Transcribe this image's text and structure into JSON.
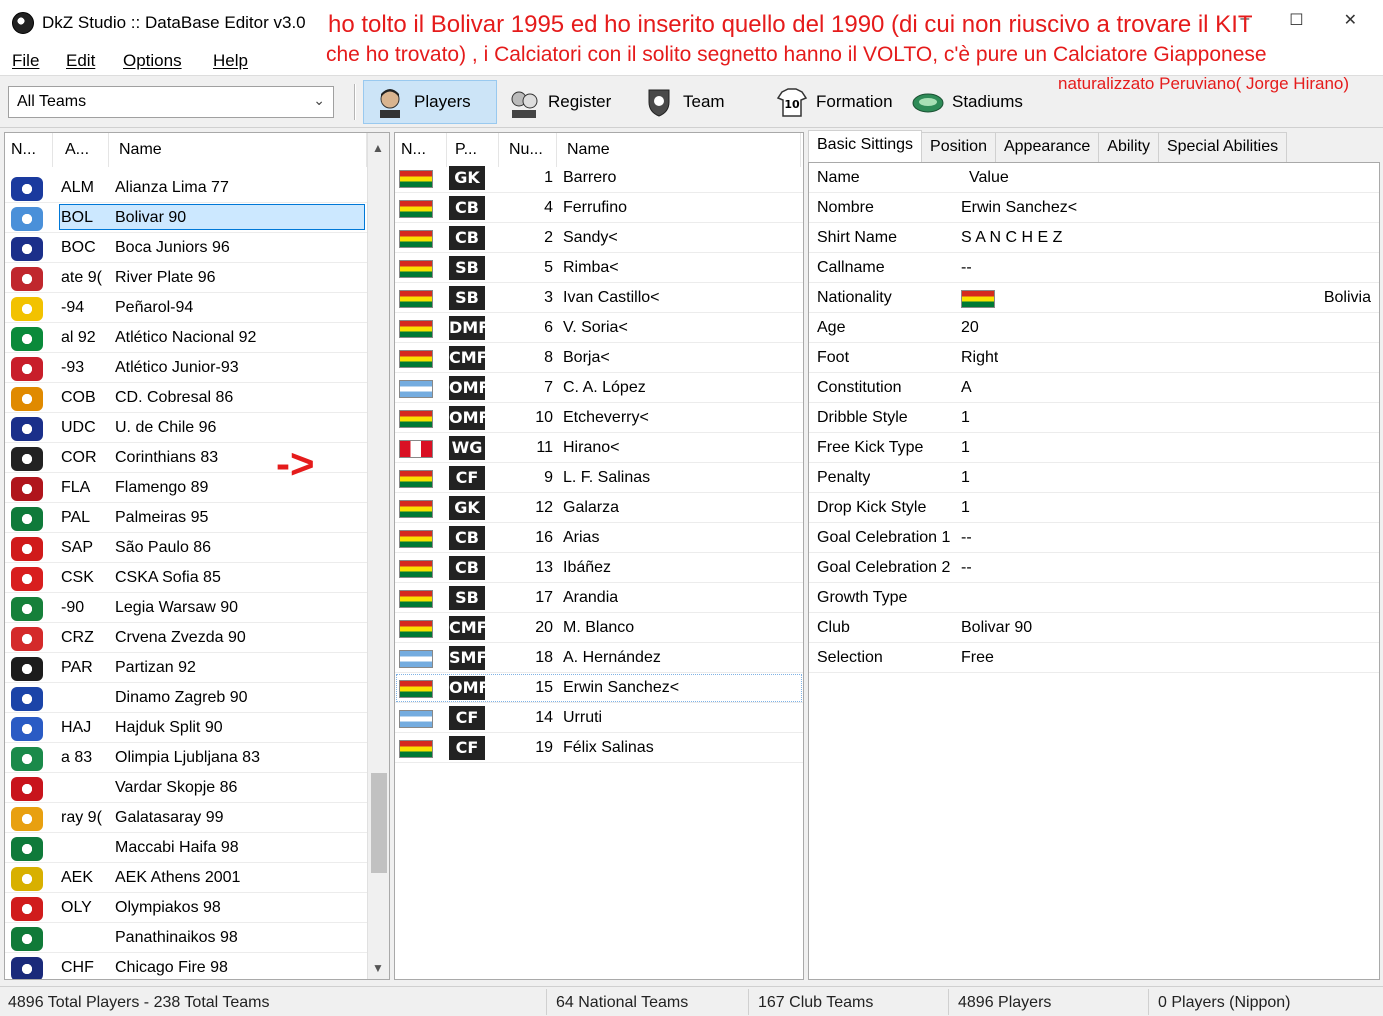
{
  "window": {
    "title": "DkZ Studio :: DataBase Editor v3.0",
    "minimize": "–",
    "maximize": "☐",
    "close": "✕"
  },
  "menu": [
    "File",
    "Edit",
    "Options",
    "Help"
  ],
  "annotation": {
    "line1": "ho tolto il Bolivar 1995 ed ho inserito quello del 1990 (di cui non riuscivo a trovare il KIT",
    "line2": "che ho trovato) , i Calciatori con il solito segnetto hanno il VOLTO, c'è pure un Calciatore Giapponese",
    "line3": "naturalizzato Peruviano( Jorge Hirano)",
    "arrow": "->"
  },
  "toolbar": {
    "team_filter": "All Teams",
    "buttons": [
      "Players",
      "Register",
      "Team",
      "Formation",
      "Stadiums"
    ],
    "formation_badge": "10"
  },
  "teams_table": {
    "headers": [
      "N...",
      "A...",
      "Name"
    ],
    "rows": [
      {
        "abbr": "ALM",
        "name": "Alianza Lima 77",
        "color": "#1a3a9e"
      },
      {
        "abbr": "BOL",
        "name": "Bolivar 90",
        "color": "#4a90d9",
        "selected": true
      },
      {
        "abbr": "BOC",
        "name": "Boca Juniors 96",
        "color": "#1b2f8a"
      },
      {
        "abbr": "ate 9(",
        "name": "River Plate 96",
        "color": "#c0272d"
      },
      {
        "abbr": "-94",
        "name": "Peñarol-94",
        "color": "#f2c200"
      },
      {
        "abbr": "al 92",
        "name": "Atlético Nacional 92",
        "color": "#0a8a3a"
      },
      {
        "abbr": "-93",
        "name": "Atlético Junior-93",
        "color": "#c81e2a"
      },
      {
        "abbr": "COB",
        "name": "CD. Cobresal 86",
        "color": "#e08a00"
      },
      {
        "abbr": "UDC",
        "name": "U. de Chile 96",
        "color": "#1a2f8a"
      },
      {
        "abbr": "COR",
        "name": "Corinthians 83",
        "color": "#222222"
      },
      {
        "abbr": "FLA",
        "name": "Flamengo 89",
        "color": "#b0151c"
      },
      {
        "abbr": "PAL",
        "name": "Palmeiras 95",
        "color": "#0f7a3a"
      },
      {
        "abbr": "SAP",
        "name": "São Paulo 86",
        "color": "#d01a1a"
      },
      {
        "abbr": "CSK",
        "name": "CSKA Sofia 85",
        "color": "#d81e1e"
      },
      {
        "abbr": "-90",
        "name": "Legia Warsaw 90",
        "color": "#16803a"
      },
      {
        "abbr": "CRZ",
        "name": "Crvena Zvezda 90",
        "color": "#d42a2a"
      },
      {
        "abbr": "PAR",
        "name": "Partizan 92",
        "color": "#1c1c1c"
      },
      {
        "abbr": "",
        "name": "Dinamo Zagreb 90",
        "color": "#1b44a8"
      },
      {
        "abbr": "HAJ",
        "name": "Hajduk Split 90",
        "color": "#2a5bc4"
      },
      {
        "abbr": "a 83",
        "name": "Olimpia Ljubljana 83",
        "color": "#1a8a4a"
      },
      {
        "abbr": "",
        "name": "Vardar Skopje 86",
        "color": "#c8141c"
      },
      {
        "abbr": "ray 9(",
        "name": "Galatasaray 99",
        "color": "#e8a010"
      },
      {
        "abbr": "",
        "name": "Maccabi Haifa 98",
        "color": "#0f7a3a"
      },
      {
        "abbr": "AEK",
        "name": "AEK Athens 2001",
        "color": "#d8b000"
      },
      {
        "abbr": "OLY",
        "name": "Olympiakos 98",
        "color": "#d01c1c"
      },
      {
        "abbr": "",
        "name": "Panathinaikos 98",
        "color": "#107a38"
      },
      {
        "abbr": "CHF",
        "name": "Chicago Fire 98",
        "color": "#1a2a7a"
      }
    ]
  },
  "players_table": {
    "headers": [
      "N...",
      "P...",
      "Nu...",
      "Name"
    ],
    "rows": [
      {
        "flag": "bol",
        "pos": "GK",
        "num": "1",
        "name": "Barrero"
      },
      {
        "flag": "bol",
        "pos": "CB",
        "num": "4",
        "name": "Ferrufino"
      },
      {
        "flag": "bol",
        "pos": "CB",
        "num": "2",
        "name": "Sandy<"
      },
      {
        "flag": "bol",
        "pos": "SB",
        "num": "5",
        "name": "Rimba<"
      },
      {
        "flag": "bol",
        "pos": "SB",
        "num": "3",
        "name": "Ivan Castillo<"
      },
      {
        "flag": "bol",
        "pos": "DMF",
        "num": "6",
        "name": "V. Soria<"
      },
      {
        "flag": "bol",
        "pos": "CMF",
        "num": "8",
        "name": "Borja<"
      },
      {
        "flag": "arg",
        "pos": "OMF",
        "num": "7",
        "name": "C. A. López"
      },
      {
        "flag": "bol",
        "pos": "OMF",
        "num": "10",
        "name": "Etcheverry<"
      },
      {
        "flag": "per",
        "pos": "WG",
        "num": "11",
        "name": "Hirano<"
      },
      {
        "flag": "bol",
        "pos": "CF",
        "num": "9",
        "name": "L. F. Salinas"
      },
      {
        "flag": "bol",
        "pos": "GK",
        "num": "12",
        "name": "Galarza"
      },
      {
        "flag": "bol",
        "pos": "CB",
        "num": "16",
        "name": "Arias"
      },
      {
        "flag": "bol",
        "pos": "CB",
        "num": "13",
        "name": "Ibáñez"
      },
      {
        "flag": "bol",
        "pos": "SB",
        "num": "17",
        "name": "Arandia"
      },
      {
        "flag": "bol",
        "pos": "CMF",
        "num": "20",
        "name": "M. Blanco"
      },
      {
        "flag": "arg",
        "pos": "SMF",
        "num": "18",
        "name": "A. Hernández"
      },
      {
        "flag": "bol",
        "pos": "OMF",
        "num": "15",
        "name": "Erwin Sanchez<",
        "focused": true
      },
      {
        "flag": "arg",
        "pos": "CF",
        "num": "14",
        "name": "Urruti"
      },
      {
        "flag": "bol",
        "pos": "CF",
        "num": "19",
        "name": "Félix Salinas"
      }
    ]
  },
  "tabs": [
    "Basic Sittings",
    "Position",
    "Appearance",
    "Ability",
    "Special Abilities"
  ],
  "properties": {
    "headers": [
      "Name",
      "Value"
    ],
    "rows": [
      {
        "key": "Nombre",
        "value": "Erwin Sanchez<"
      },
      {
        "key": "Shirt Name",
        "value": "S A N C H E Z"
      },
      {
        "key": "Callname",
        "value": "--"
      },
      {
        "key": "Nationality",
        "value": "Bolivia",
        "flag": "bol"
      },
      {
        "key": "Age",
        "value": "20"
      },
      {
        "key": "Foot",
        "value": "Right"
      },
      {
        "key": "Constitution",
        "value": "A"
      },
      {
        "key": "Dribble Style",
        "value": "1"
      },
      {
        "key": "Free Kick Type",
        "value": "1"
      },
      {
        "key": "Penalty",
        "value": "1"
      },
      {
        "key": "Drop Kick Style",
        "value": "1"
      },
      {
        "key": "Goal Celebration 1",
        "value": "--"
      },
      {
        "key": "Goal Celebration 2",
        "value": "--"
      },
      {
        "key": "Growth Type",
        "value": ""
      },
      {
        "key": "Club",
        "value": "Bolivar 90"
      },
      {
        "key": "Selection",
        "value": "Free"
      }
    ]
  },
  "status": {
    "totals": "4896 Total Players  -  238 Total Teams",
    "national": "64 National Teams",
    "club": "167 Club Teams",
    "players": "4896 Players",
    "nippon": "0 Players (Nippon)"
  }
}
